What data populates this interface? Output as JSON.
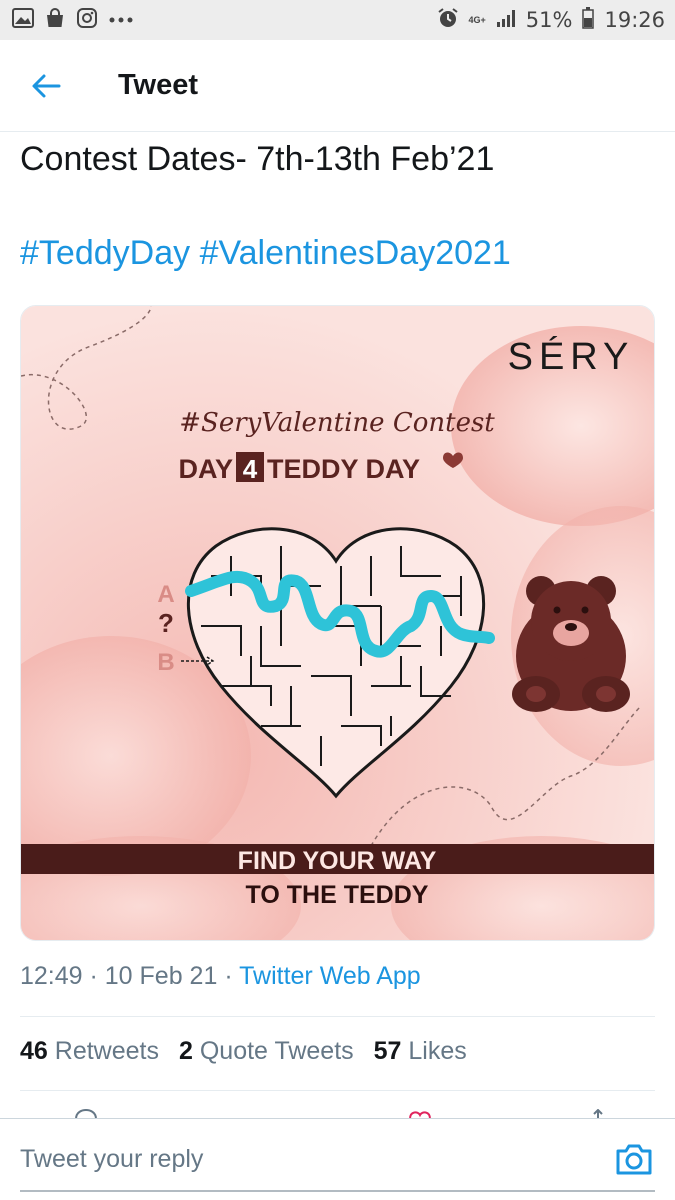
{
  "status_bar": {
    "network": "4G+",
    "battery": "51%",
    "time": "19:26",
    "icons": [
      "image-icon",
      "bag-icon",
      "instagram-icon",
      "more-icon",
      "alarm-icon",
      "signal-icon",
      "battery-icon"
    ]
  },
  "header": {
    "title": "Tweet",
    "back_icon": "arrow-left-icon",
    "accent": "#1b95e0"
  },
  "tweet": {
    "text_line": "Contest Dates- 7th-13th Feb’21",
    "hashtags": [
      "#TeddyDay",
      "#ValentinesDay2021"
    ]
  },
  "media": {
    "brand": "SÉRY",
    "contest_tag": "#SeryValentine Contest",
    "day_prefix": "DAY",
    "day_number": "4",
    "day_suffix": "TEDDY DAY",
    "label_a": "A",
    "label_q": "?",
    "label_b": "B",
    "banner_line1": "FIND YOUR WAY",
    "banner_line2": "TO THE TEDDY",
    "colors": {
      "background": "#f7cfc9",
      "banner": "#4a1c1a",
      "path": "#2ec3d8",
      "teddy": "#6b2a27"
    }
  },
  "meta": {
    "time": "12:49",
    "sep1": " · ",
    "date": "10 Feb 21",
    "sep2": " · ",
    "source": "Twitter Web App"
  },
  "stats": {
    "retweets_count": "46",
    "retweets_label": "Retweets",
    "quotes_count": "2",
    "quotes_label": "Quote Tweets",
    "likes_count": "57",
    "likes_label": "Likes"
  },
  "reply": {
    "placeholder": "Tweet your reply",
    "camera_icon": "camera-icon"
  }
}
